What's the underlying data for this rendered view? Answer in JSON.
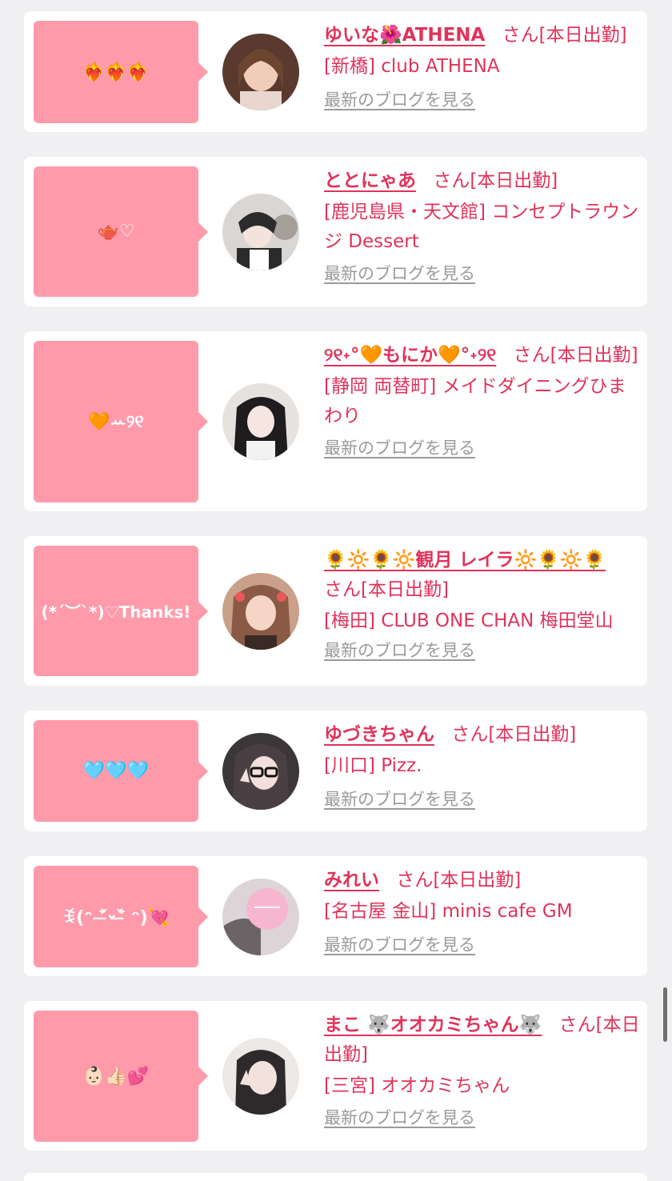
{
  "blog_link_label": "最新のブログを見る",
  "colors": {
    "accent": "#e0335a",
    "bubble": "#ff9aab",
    "link_gray": "#9a9a9a",
    "background": "#f0f0f2"
  },
  "entries": [
    {
      "bubble_text": "❤️‍🔥❤️‍🔥❤️‍🔥",
      "name": "ゆいな🌺ATHENA",
      "suffix": "さん[本日出勤]",
      "shop": "[新橋] club ATHENA",
      "avatar_icon": "avatar-photo"
    },
    {
      "bubble_text": "🫖♡",
      "name": "ととにゃあ",
      "suffix": "さん[本日出勤]",
      "shop": "[鹿児島県・天文館] コンセプトラウンジ Dessert",
      "avatar_icon": "avatar-photo"
    },
    {
      "bubble_text": "🧡ꕀ୨୧",
      "name": "୨୧˖°🧡もにか🧡°˖୨୧",
      "suffix": "さん[本日出勤]",
      "shop": "[静岡 両替町] メイドダイニングひまわり",
      "avatar_icon": "avatar-photo"
    },
    {
      "bubble_text": "(*´︶`*)♡Thanks!",
      "name": "🌻🔆🌻🔆観月 レイラ🔆🌻🔆🌻",
      "suffix": "さん[本日出勤]",
      "shop": "[梅田] CLUB ONE CHAN 梅田堂山",
      "avatar_icon": "avatar-photo"
    },
    {
      "bubble_text": "🩵🩵🩵",
      "name": "ゆづきちゃん",
      "suffix": "さん[本日出勤]",
      "shop": "[川口] Pizz.",
      "avatar_icon": "avatar-photo"
    },
    {
      "bubble_text": "ꉂ(ᵔ ˃̶᷄ᵕ˂̶᷅ ᵔ)💘",
      "name": "みれい",
      "suffix": "さん[本日出勤]",
      "shop": "[名古屋 金山] minis cafe GM",
      "avatar_icon": "avatar-photo"
    },
    {
      "bubble_text": "👶🏻👍🏻💕",
      "name": "まこ 🐺オオカミちゃん🐺",
      "suffix": "さん[本日出勤]",
      "shop": "[三宮] オオカミちゃん",
      "avatar_icon": "avatar-photo"
    }
  ]
}
